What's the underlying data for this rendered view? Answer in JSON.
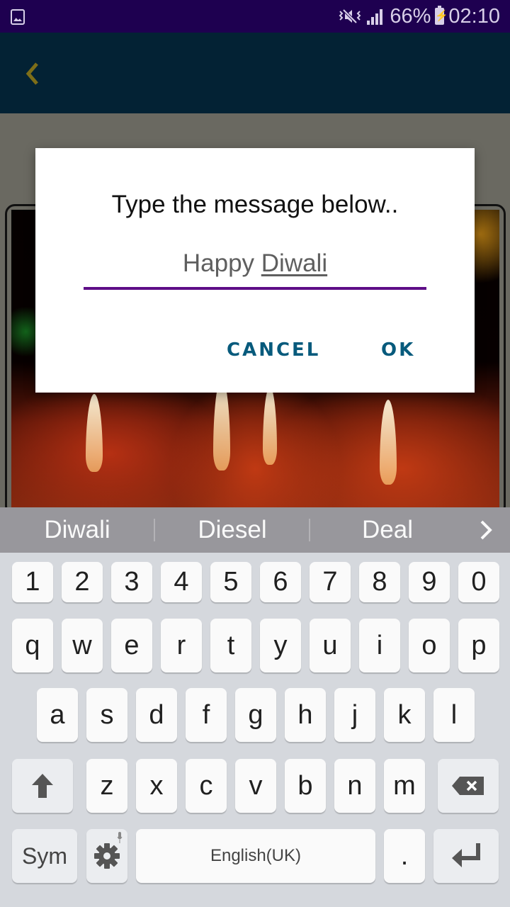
{
  "status_bar": {
    "left_icon": "gallery-icon",
    "icons": [
      "vibrate-mute-icon",
      "signal-icon",
      "battery-charging-icon"
    ],
    "battery": "66%",
    "time": "02:10"
  },
  "app_bar": {
    "back_icon": "chevron-left-icon",
    "back_color": "#8a7a1a"
  },
  "dialog": {
    "title": "Type the message below..",
    "input": {
      "committed": "Happy ",
      "composing": "Diwali",
      "value": "Happy Diwali"
    },
    "cancel_label": "CANCEL",
    "ok_label": "OK",
    "accent_color": "#5e0d87",
    "button_color": "#075a7c"
  },
  "keyboard": {
    "suggestions": [
      "Diwali",
      "Diesel",
      "Deal"
    ],
    "more_icon": "chevron-right-icon",
    "number_row": [
      "1",
      "2",
      "3",
      "4",
      "5",
      "6",
      "7",
      "8",
      "9",
      "0"
    ],
    "row1": [
      "q",
      "w",
      "e",
      "r",
      "t",
      "y",
      "u",
      "i",
      "o",
      "p"
    ],
    "row2": [
      "a",
      "s",
      "d",
      "f",
      "g",
      "h",
      "j",
      "k",
      "l"
    ],
    "row3": [
      "z",
      "x",
      "c",
      "v",
      "b",
      "n",
      "m"
    ],
    "shift_icon": "shift-arrow-icon",
    "backspace_icon": "backspace-icon",
    "sym_label": "Sym",
    "settings_icon": "gear-icon",
    "mic_hint_icon": "microphone-icon",
    "space_label": "English(UK)",
    "period_label": ".",
    "enter_icon": "enter-icon"
  }
}
